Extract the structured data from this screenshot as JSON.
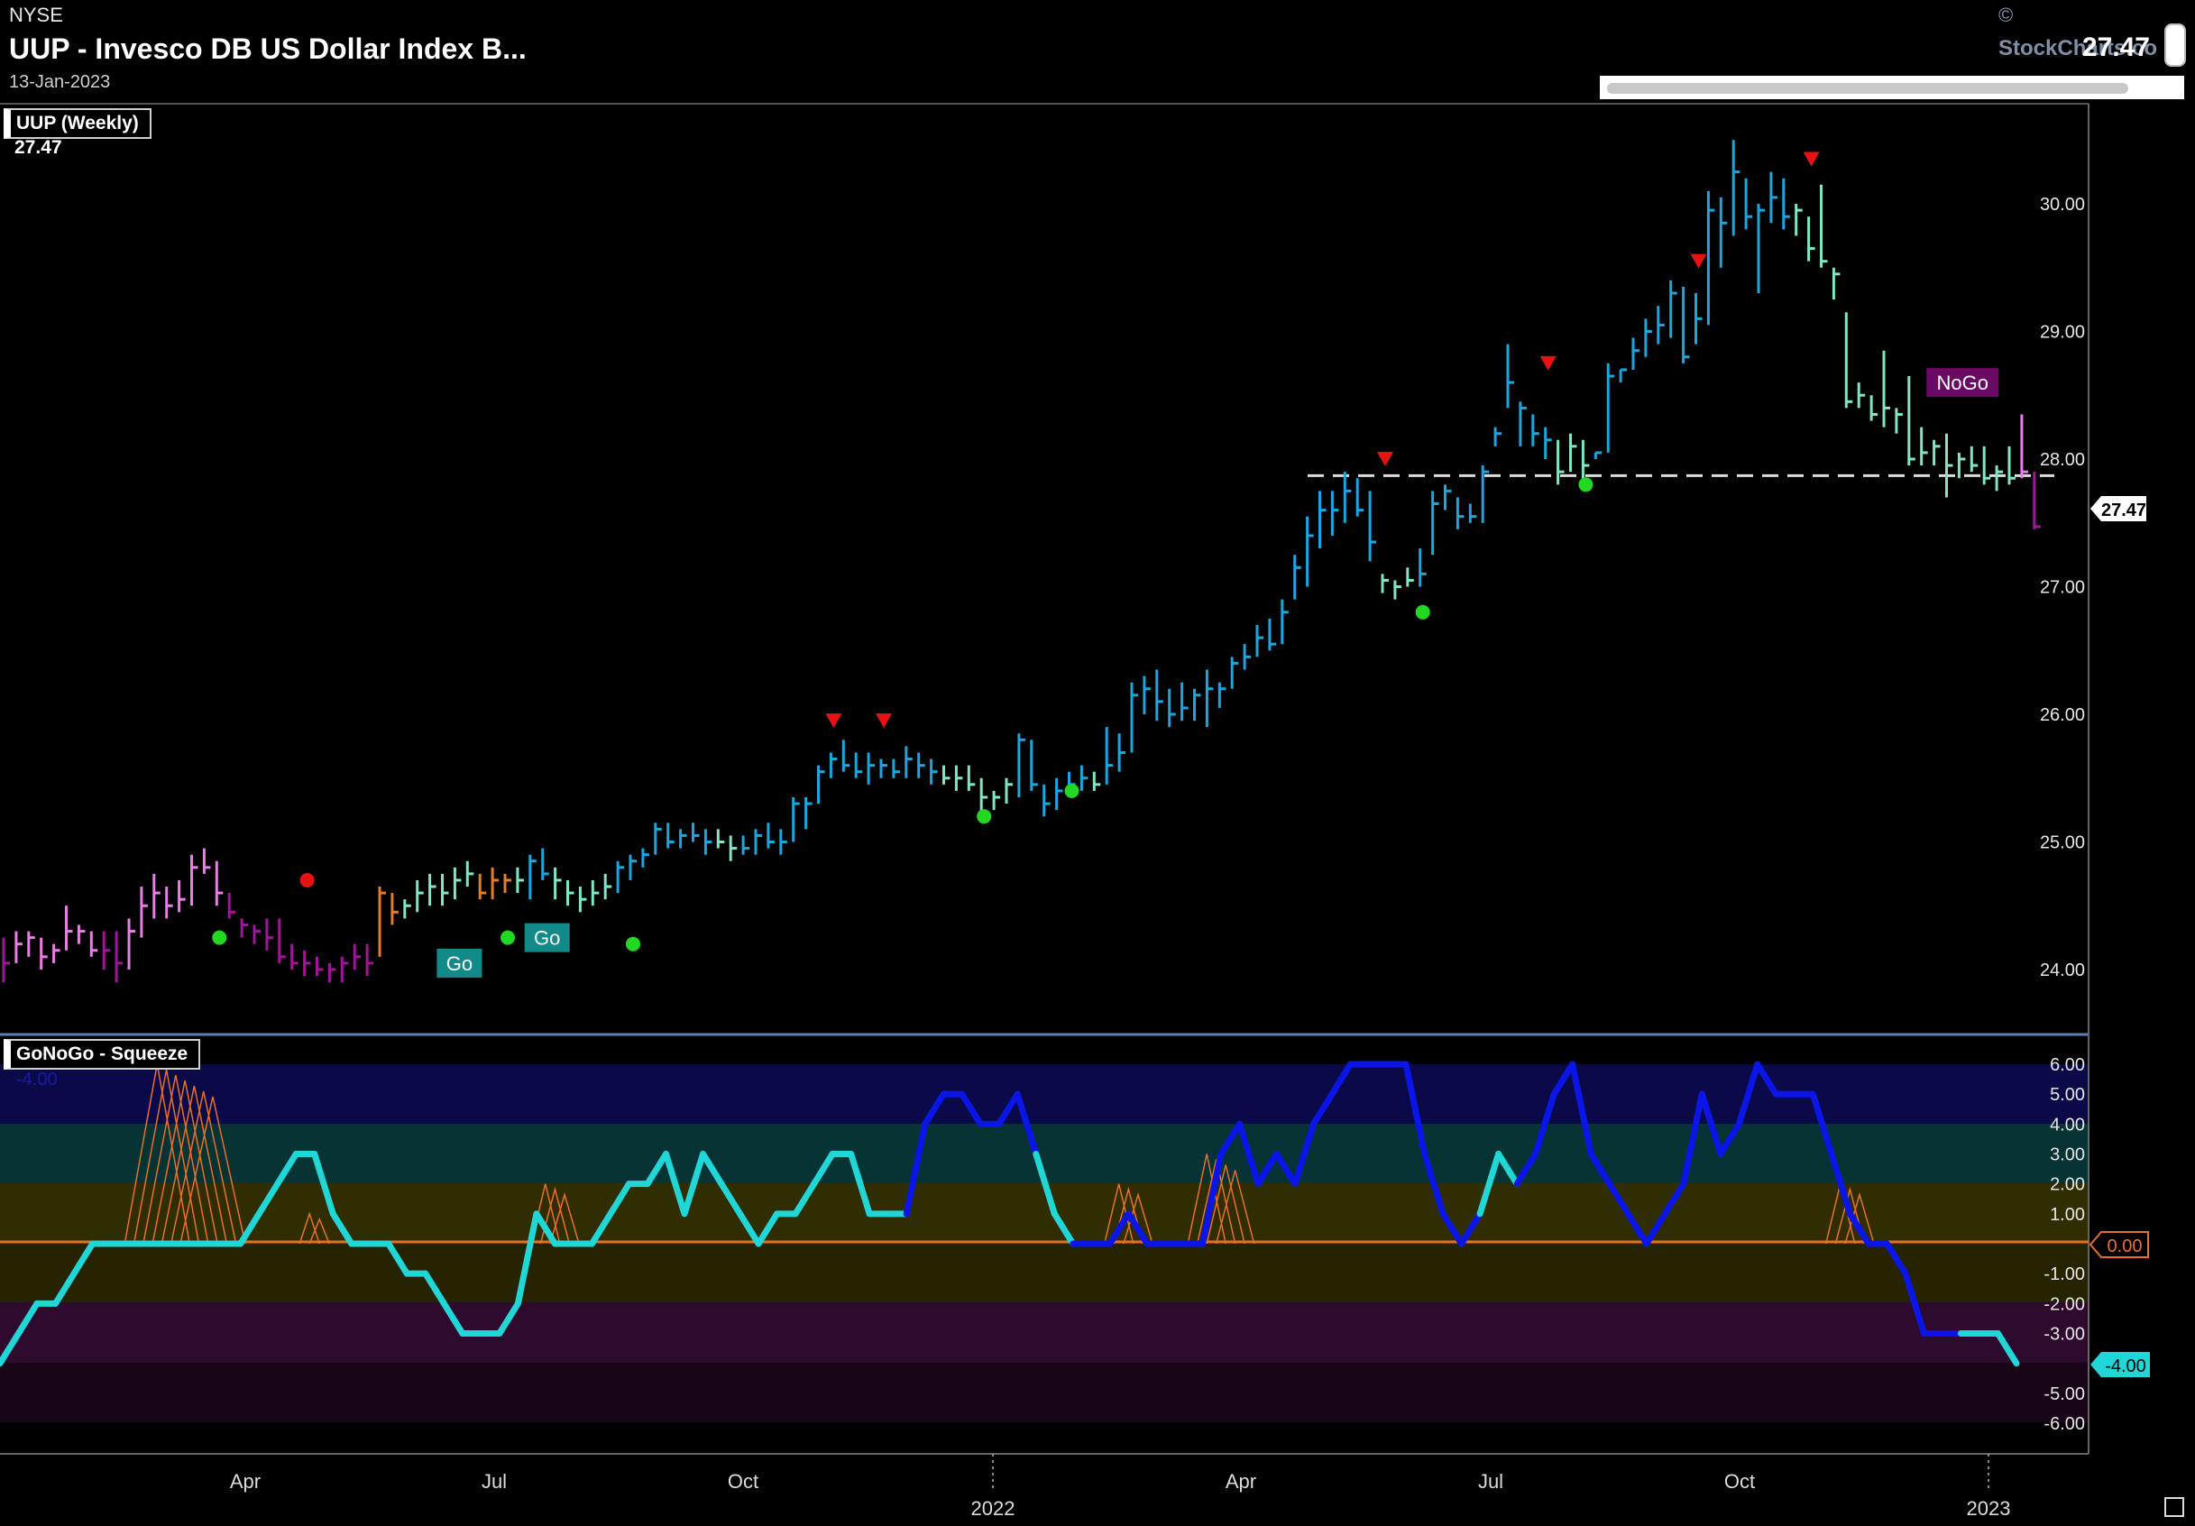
{
  "header": {
    "exchange": "NYSE",
    "title": "UUP - Invesco DB US Dollar Index B...",
    "date": "13-Jan-2023",
    "last_price": "27.47",
    "copyright": "©",
    "brand": "StockCharts.co"
  },
  "price_panel": {
    "label": "UUP (Weekly)",
    "value": "27.47",
    "current_tag": "27.47",
    "nogo_label": "NoGo",
    "go_label": "Go",
    "y_ticks": [
      "30.00",
      "29.00",
      "28.00",
      "27.00",
      "26.00",
      "25.00",
      "24.00"
    ],
    "resistance_level": 27.87
  },
  "squeeze_panel": {
    "label": "GoNoGo - Squeeze",
    "ghost_value": "-4.00",
    "zero_tag": "0.00",
    "current_tag": "-4.00",
    "y_ticks": [
      "6.00",
      "5.00",
      "4.00",
      "3.00",
      "2.00",
      "1.00",
      "-1.00",
      "-2.00",
      "-3.00",
      "-5.00",
      "-6.00"
    ]
  },
  "x_axis": {
    "months": [
      "Apr",
      "Jul",
      "Oct",
      "Apr",
      "Jul",
      "Oct"
    ],
    "years": [
      "2022",
      "2023"
    ]
  },
  "colors": {
    "strong_go": "#1aa7e0",
    "weak_go": "#7fe6c6",
    "go_fading": "#e87b2a",
    "nogo": "#a0169a",
    "weak_nogo": "#e97fe6",
    "osc_go": "#0a16e8",
    "osc_nogo": "#20d6d6",
    "squeeze_grid": "#e8702a",
    "zero_line": "#e8702a",
    "green_dot": "#22d822",
    "red_triangle": "#e81212"
  },
  "chart_data": [
    {
      "type": "ohlc",
      "title": "UUP - Invesco DB US Dollar Index B...",
      "timeframe": "Weekly",
      "ylim": [
        23.85,
        30.6
      ],
      "bars": [
        [
          24.25,
          23.9,
          24.05,
          "nogo"
        ],
        [
          24.3,
          24.05,
          24.2,
          "weak_nogo"
        ],
        [
          24.3,
          24.1,
          24.25,
          "weak_nogo"
        ],
        [
          24.25,
          24.0,
          24.1,
          "weak_nogo"
        ],
        [
          24.2,
          24.05,
          24.15,
          "weak_nogo"
        ],
        [
          24.5,
          24.15,
          24.3,
          "weak_nogo"
        ],
        [
          24.35,
          24.2,
          24.3,
          "weak_nogo"
        ],
        [
          24.3,
          24.1,
          24.15,
          "weak_nogo"
        ],
        [
          24.3,
          24.0,
          24.15,
          "nogo"
        ],
        [
          24.3,
          23.9,
          24.05,
          "nogo"
        ],
        [
          24.4,
          24.0,
          24.3,
          "weak_nogo"
        ],
        [
          24.65,
          24.25,
          24.5,
          "weak_nogo"
        ],
        [
          24.75,
          24.4,
          24.6,
          "weak_nogo"
        ],
        [
          24.65,
          24.4,
          24.5,
          "weak_nogo"
        ],
        [
          24.7,
          24.45,
          24.55,
          "weak_nogo"
        ],
        [
          24.9,
          24.5,
          24.8,
          "weak_nogo"
        ],
        [
          24.95,
          24.75,
          24.8,
          "weak_nogo"
        ],
        [
          24.85,
          24.5,
          24.6,
          "weak_nogo"
        ],
        [
          24.6,
          24.4,
          24.45,
          "nogo"
        ],
        [
          24.4,
          24.25,
          24.35,
          "nogo"
        ],
        [
          24.35,
          24.2,
          24.3,
          "nogo"
        ],
        [
          24.4,
          24.15,
          24.25,
          "nogo"
        ],
        [
          24.4,
          24.05,
          24.1,
          "nogo"
        ],
        [
          24.2,
          24.0,
          24.05,
          "nogo"
        ],
        [
          24.15,
          23.95,
          24.05,
          "nogo"
        ],
        [
          24.1,
          23.95,
          24.0,
          "nogo"
        ],
        [
          24.05,
          23.9,
          24.0,
          "nogo"
        ],
        [
          24.1,
          23.9,
          24.05,
          "nogo"
        ],
        [
          24.2,
          24.0,
          24.1,
          "nogo"
        ],
        [
          24.2,
          23.95,
          24.05,
          "nogo"
        ],
        [
          24.65,
          24.1,
          24.6,
          "go_fading"
        ],
        [
          24.6,
          24.35,
          24.45,
          "go_fading"
        ],
        [
          24.55,
          24.4,
          24.5,
          "weak_go"
        ],
        [
          24.7,
          24.45,
          24.6,
          "weak_go"
        ],
        [
          24.75,
          24.5,
          24.65,
          "weak_go"
        ],
        [
          24.75,
          24.5,
          24.6,
          "weak_go"
        ],
        [
          24.8,
          24.55,
          24.7,
          "weak_go"
        ],
        [
          24.85,
          24.65,
          24.75,
          "weak_go"
        ],
        [
          24.75,
          24.55,
          24.6,
          "go_fading"
        ],
        [
          24.8,
          24.55,
          24.7,
          "go_fading"
        ],
        [
          24.75,
          24.6,
          24.7,
          "go_fading"
        ],
        [
          24.8,
          24.6,
          24.7,
          "weak_go"
        ],
        [
          24.9,
          24.55,
          24.85,
          "strong_go"
        ],
        [
          24.95,
          24.7,
          24.75,
          "strong_go"
        ],
        [
          24.8,
          24.55,
          24.7,
          "weak_go"
        ],
        [
          24.7,
          24.5,
          24.6,
          "weak_go"
        ],
        [
          24.65,
          24.45,
          24.55,
          "weak_go"
        ],
        [
          24.7,
          24.5,
          24.6,
          "weak_go"
        ],
        [
          24.75,
          24.55,
          24.65,
          "weak_go"
        ],
        [
          24.85,
          24.6,
          24.8,
          "strong_go"
        ],
        [
          24.9,
          24.7,
          24.85,
          "strong_go"
        ],
        [
          24.95,
          24.8,
          24.9,
          "strong_go"
        ],
        [
          25.15,
          24.9,
          25.1,
          "strong_go"
        ],
        [
          25.15,
          24.95,
          25.0,
          "strong_go"
        ],
        [
          25.1,
          24.95,
          25.05,
          "strong_go"
        ],
        [
          25.15,
          25.0,
          25.05,
          "strong_go"
        ],
        [
          25.1,
          24.9,
          25.0,
          "strong_go"
        ],
        [
          25.1,
          24.95,
          25.0,
          "weak_go"
        ],
        [
          25.05,
          24.85,
          24.95,
          "weak_go"
        ],
        [
          25.05,
          24.9,
          24.95,
          "strong_go"
        ],
        [
          25.1,
          24.9,
          25.05,
          "strong_go"
        ],
        [
          25.15,
          24.95,
          25.0,
          "strong_go"
        ],
        [
          25.1,
          24.9,
          25.0,
          "strong_go"
        ],
        [
          25.35,
          25.0,
          25.3,
          "strong_go"
        ],
        [
          25.35,
          25.1,
          25.3,
          "strong_go"
        ],
        [
          25.6,
          25.3,
          25.55,
          "strong_go"
        ],
        [
          25.7,
          25.5,
          25.65,
          "strong_go"
        ],
        [
          25.8,
          25.55,
          25.6,
          "strong_go"
        ],
        [
          25.7,
          25.5,
          25.55,
          "strong_go"
        ],
        [
          25.7,
          25.45,
          25.6,
          "strong_go"
        ],
        [
          25.65,
          25.5,
          25.6,
          "strong_go"
        ],
        [
          25.65,
          25.5,
          25.55,
          "strong_go"
        ],
        [
          25.75,
          25.5,
          25.65,
          "strong_go"
        ],
        [
          25.7,
          25.5,
          25.6,
          "strong_go"
        ],
        [
          25.65,
          25.45,
          25.55,
          "strong_go"
        ],
        [
          25.6,
          25.45,
          25.5,
          "weak_go"
        ],
        [
          25.6,
          25.4,
          25.5,
          "weak_go"
        ],
        [
          25.6,
          25.4,
          25.45,
          "weak_go"
        ],
        [
          25.5,
          25.15,
          25.35,
          "weak_go"
        ],
        [
          25.4,
          25.25,
          25.35,
          "weak_go"
        ],
        [
          25.5,
          25.3,
          25.45,
          "weak_go"
        ],
        [
          25.85,
          25.35,
          25.8,
          "strong_go"
        ],
        [
          25.8,
          25.4,
          25.45,
          "strong_go"
        ],
        [
          25.45,
          25.2,
          25.3,
          "strong_go"
        ],
        [
          25.5,
          25.25,
          25.4,
          "strong_go"
        ],
        [
          25.55,
          25.35,
          25.45,
          "strong_go"
        ],
        [
          25.6,
          25.4,
          25.5,
          "strong_go"
        ],
        [
          25.55,
          25.4,
          25.45,
          "weak_go"
        ],
        [
          25.9,
          25.45,
          25.6,
          "strong_go"
        ],
        [
          25.85,
          25.55,
          25.7,
          "strong_go"
        ],
        [
          26.25,
          25.7,
          26.15,
          "strong_go"
        ],
        [
          26.3,
          26.0,
          26.2,
          "strong_go"
        ],
        [
          26.35,
          25.95,
          26.1,
          "strong_go"
        ],
        [
          26.2,
          25.9,
          26.0,
          "strong_go"
        ],
        [
          26.25,
          25.95,
          26.05,
          "strong_go"
        ],
        [
          26.2,
          25.95,
          26.15,
          "strong_go"
        ],
        [
          26.35,
          25.9,
          26.2,
          "strong_go"
        ],
        [
          26.25,
          26.05,
          26.2,
          "strong_go"
        ],
        [
          26.45,
          26.2,
          26.4,
          "strong_go"
        ],
        [
          26.55,
          26.35,
          26.45,
          "strong_go"
        ],
        [
          26.7,
          26.45,
          26.6,
          "strong_go"
        ],
        [
          26.75,
          26.5,
          26.55,
          "strong_go"
        ],
        [
          26.9,
          26.55,
          26.8,
          "strong_go"
        ],
        [
          27.25,
          26.9,
          27.15,
          "strong_go"
        ],
        [
          27.55,
          27.0,
          27.4,
          "strong_go"
        ],
        [
          27.75,
          27.3,
          27.6,
          "strong_go"
        ],
        [
          27.75,
          27.4,
          27.6,
          "strong_go"
        ],
        [
          27.9,
          27.5,
          27.75,
          "strong_go"
        ],
        [
          27.85,
          27.55,
          27.6,
          "strong_go"
        ],
        [
          27.75,
          27.2,
          27.35,
          "strong_go"
        ],
        [
          27.1,
          26.95,
          27.05,
          "weak_go"
        ],
        [
          27.05,
          26.9,
          27.0,
          "weak_go"
        ],
        [
          27.15,
          27.0,
          27.05,
          "weak_go"
        ],
        [
          27.3,
          27.0,
          27.1,
          "strong_go"
        ],
        [
          27.75,
          27.25,
          27.65,
          "strong_go"
        ],
        [
          27.8,
          27.6,
          27.75,
          "strong_go"
        ],
        [
          27.7,
          27.45,
          27.55,
          "strong_go"
        ],
        [
          27.65,
          27.5,
          27.55,
          "strong_go"
        ],
        [
          27.95,
          27.5,
          27.9,
          "strong_go"
        ],
        [
          28.25,
          28.1,
          28.2,
          "strong_go"
        ],
        [
          28.9,
          28.4,
          28.6,
          "strong_go"
        ],
        [
          28.45,
          28.1,
          28.4,
          "strong_go"
        ],
        [
          28.35,
          28.1,
          28.2,
          "strong_go"
        ],
        [
          28.25,
          28.0,
          28.15,
          "strong_go"
        ],
        [
          28.15,
          27.8,
          27.9,
          "weak_go"
        ],
        [
          28.2,
          27.9,
          28.1,
          "weak_go"
        ],
        [
          28.15,
          27.75,
          27.95,
          "weak_go"
        ],
        [
          28.05,
          28.0,
          28.05,
          "strong_go"
        ],
        [
          28.75,
          28.05,
          28.65,
          "strong_go"
        ],
        [
          28.7,
          28.6,
          28.7,
          "strong_go"
        ],
        [
          28.95,
          28.7,
          28.85,
          "strong_go"
        ],
        [
          29.1,
          28.8,
          29.0,
          "strong_go"
        ],
        [
          29.2,
          28.9,
          29.05,
          "strong_go"
        ],
        [
          29.4,
          28.95,
          29.3,
          "strong_go"
        ],
        [
          29.35,
          28.75,
          28.8,
          "strong_go"
        ],
        [
          29.3,
          28.9,
          29.1,
          "strong_go"
        ],
        [
          30.1,
          29.05,
          29.95,
          "strong_go"
        ],
        [
          30.05,
          29.5,
          29.85,
          "strong_go"
        ],
        [
          30.5,
          29.75,
          30.25,
          "strong_go"
        ],
        [
          30.2,
          29.8,
          29.9,
          "strong_go"
        ],
        [
          30.0,
          29.3,
          29.95,
          "strong_go"
        ],
        [
          30.25,
          29.85,
          30.05,
          "strong_go"
        ],
        [
          30.2,
          29.8,
          29.9,
          "strong_go"
        ],
        [
          30.0,
          29.75,
          29.95,
          "weak_go"
        ],
        [
          29.9,
          29.55,
          29.65,
          "weak_go"
        ],
        [
          30.15,
          29.5,
          29.55,
          "weak_go"
        ],
        [
          29.5,
          29.25,
          29.45,
          "weak_go"
        ],
        [
          29.15,
          28.4,
          28.45,
          "weak_go"
        ],
        [
          28.6,
          28.4,
          28.5,
          "weak_go"
        ],
        [
          28.5,
          28.3,
          28.35,
          "weak_go"
        ],
        [
          28.85,
          28.25,
          28.4,
          "weak_go"
        ],
        [
          28.4,
          28.2,
          28.35,
          "weak_go"
        ],
        [
          28.65,
          27.95,
          28.0,
          "weak_go"
        ],
        [
          28.25,
          27.95,
          28.05,
          "weak_go"
        ],
        [
          28.15,
          27.95,
          28.1,
          "weak_go"
        ],
        [
          28.2,
          27.7,
          27.95,
          "weak_go"
        ],
        [
          28.05,
          27.85,
          28.0,
          "weak_go"
        ],
        [
          28.1,
          27.9,
          27.95,
          "weak_go"
        ],
        [
          28.1,
          27.8,
          27.85,
          "weak_go"
        ],
        [
          27.95,
          27.75,
          27.9,
          "weak_go"
        ],
        [
          28.1,
          27.8,
          27.85,
          "weak_go"
        ],
        [
          28.35,
          27.85,
          27.9,
          "weak_nogo"
        ],
        [
          27.9,
          27.45,
          27.47,
          "nogo"
        ]
      ],
      "green_dots": [
        {
          "index": 17,
          "y": 24.25
        },
        {
          "index": 40,
          "y": 24.25
        },
        {
          "index": 50,
          "y": 24.2
        },
        {
          "index": 78,
          "y": 25.2
        },
        {
          "index": 85,
          "y": 25.4
        },
        {
          "index": 113,
          "y": 26.8
        },
        {
          "index": 126,
          "y": 27.8
        }
      ],
      "red_dot": {
        "index": 24,
        "y": 24.7
      },
      "red_triangles": [
        {
          "index": 66,
          "y": 25.95
        },
        {
          "index": 70,
          "y": 25.95
        },
        {
          "index": 110,
          "y": 28.0
        },
        {
          "index": 123,
          "y": 28.75
        },
        {
          "index": 135,
          "y": 29.55
        },
        {
          "index": 144,
          "y": 30.35
        }
      ],
      "go_labels": [
        {
          "index": 36,
          "y": 24.05
        },
        {
          "index": 43,
          "y": 24.25
        }
      ],
      "nogo_label": {
        "index": 157,
        "y": 28.6
      }
    },
    {
      "type": "line",
      "title": "GoNoGo - Squeeze",
      "ylim": [
        -6,
        6
      ],
      "zero_level": 0,
      "values": [
        -4,
        -3,
        -2,
        -2,
        -1,
        0,
        0,
        0,
        0,
        0,
        0,
        0,
        0,
        0,
        1,
        2,
        3,
        3,
        1,
        0,
        0,
        0,
        -1,
        -1,
        -2,
        -3,
        -3,
        -3,
        -2,
        1,
        0,
        0,
        0,
        1,
        2,
        2,
        3,
        1,
        3,
        2,
        1,
        0,
        1,
        1,
        2,
        3,
        3,
        1,
        1,
        1,
        4,
        5,
        5,
        4,
        4,
        5,
        3,
        1,
        0,
        0,
        0,
        1,
        0,
        0,
        0,
        0,
        3,
        4,
        2,
        3,
        2,
        4,
        5,
        6,
        6,
        6,
        6,
        3,
        1,
        0,
        1,
        3,
        2,
        3,
        5,
        6,
        3,
        2,
        1,
        0,
        1,
        2,
        5,
        3,
        4,
        6,
        5,
        5,
        5,
        3,
        1,
        0,
        0,
        -1,
        -3,
        -3,
        -3,
        -3,
        -3,
        -4
      ],
      "go_ranges": [
        [
          49,
          56
        ],
        [
          58,
          80
        ],
        [
          82,
          106
        ]
      ],
      "squeeze_peaks": [
        {
          "index": 10,
          "grid": 6
        },
        {
          "index": 17,
          "grid": 1
        },
        {
          "index": 30,
          "grid": 2
        },
        {
          "index": 61,
          "grid": 2
        },
        {
          "index": 66,
          "grid": 3
        },
        {
          "index": 100,
          "grid": 2
        }
      ]
    }
  ]
}
